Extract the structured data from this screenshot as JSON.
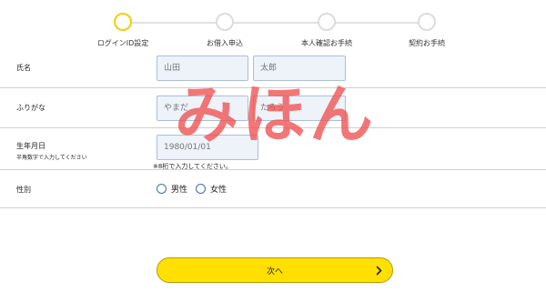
{
  "stepper": {
    "steps": [
      {
        "label": "ログインID設定",
        "state": "current"
      },
      {
        "label": "お借入申込",
        "state": "pending"
      },
      {
        "label": "本人確認お手続",
        "state": "pending"
      },
      {
        "label": "契約お手続",
        "state": "pending"
      }
    ],
    "active_color": "#f2cf00"
  },
  "form": {
    "name": {
      "label": "氏名",
      "last_placeholder": "山田",
      "first_placeholder": "太郎"
    },
    "kana": {
      "label": "ふりがな",
      "last_placeholder": "やまだ",
      "first_placeholder": "たろう"
    },
    "birthdate": {
      "label": "生年月日",
      "sublabel": "半角数字で入力してください",
      "placeholder": "1980/01/01",
      "note": "※8桁で入力してください。"
    },
    "gender": {
      "label": "性別",
      "options": [
        "男性",
        "女性"
      ]
    }
  },
  "watermark": "みほん",
  "next_button": {
    "label": "次へ",
    "color": "#ffe000"
  }
}
